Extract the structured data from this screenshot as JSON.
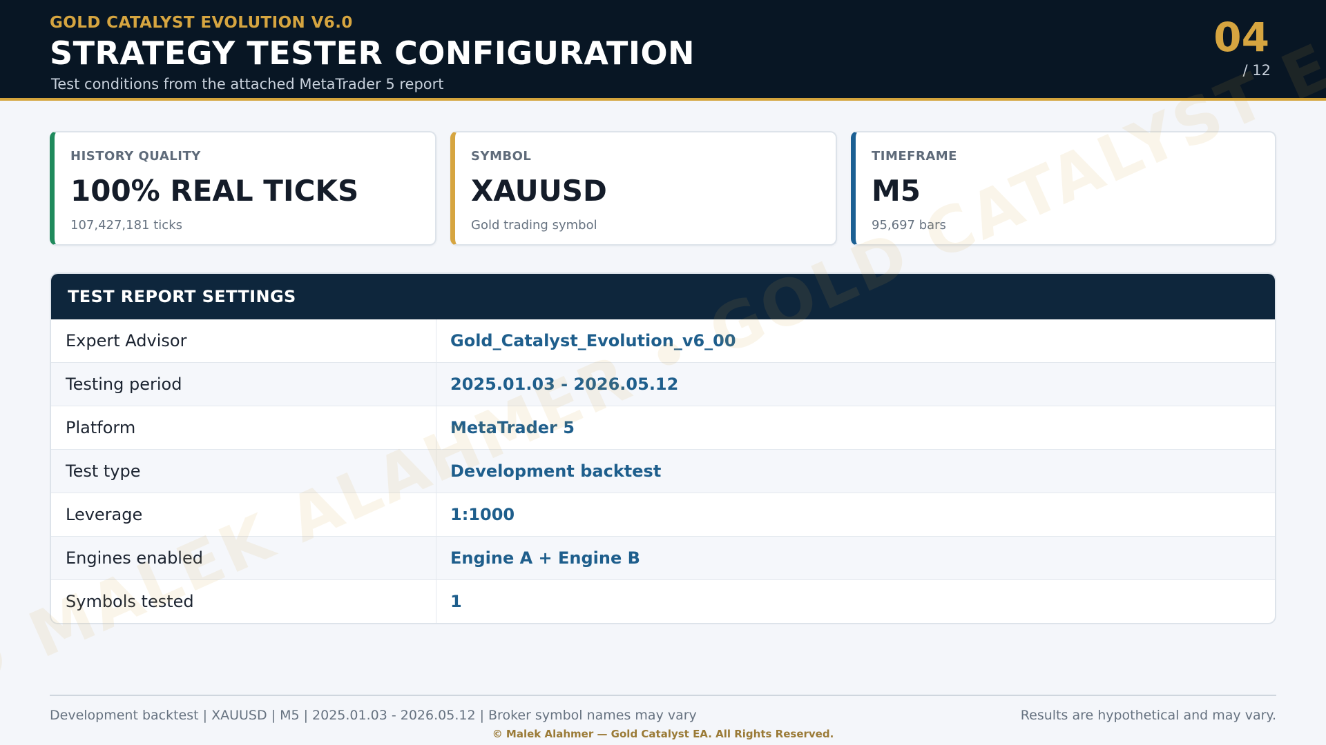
{
  "header": {
    "eyebrow": "GOLD CATALYST EVOLUTION V6.0",
    "title": "STRATEGY TESTER CONFIGURATION",
    "subtitle": "Test conditions from the attached MetaTrader 5 report",
    "page_number": "04",
    "page_total": "/ 12"
  },
  "watermark": "© MALEK ALAHMER • GOLD CATALYST EA",
  "cards": [
    {
      "label": "HISTORY QUALITY",
      "value": "100% REAL TICKS",
      "sub": "107,427,181 ticks",
      "accent": "#1f8a5c"
    },
    {
      "label": "SYMBOL",
      "value": "XAUUSD",
      "sub": "Gold trading symbol",
      "accent": "#d6a540"
    },
    {
      "label": "TIMEFRAME",
      "value": "M5",
      "sub": "95,697 bars",
      "accent": "#1b5f93"
    }
  ],
  "settings": {
    "heading": "TEST REPORT SETTINGS",
    "rows": [
      {
        "key": "Expert Advisor",
        "value": "Gold_Catalyst_Evolution_v6_00"
      },
      {
        "key": "Testing period",
        "value": "2025.01.03 - 2026.05.12"
      },
      {
        "key": "Platform",
        "value": "MetaTrader 5"
      },
      {
        "key": "Test type",
        "value": "Development backtest"
      },
      {
        "key": "Leverage",
        "value": "1:1000"
      },
      {
        "key": "Engines enabled",
        "value": "Engine A + Engine B"
      },
      {
        "key": "Symbols tested",
        "value": "1"
      }
    ]
  },
  "footer": {
    "left": "Development backtest | XAUUSD | M5 | 2025.01.03 - 2026.05.12 | Broker symbol names may vary",
    "right": "Results are hypothetical and may vary.",
    "copyright": "© Malek Alahmer — Gold Catalyst EA. All Rights Reserved."
  },
  "colors": {
    "header_bg": "#081624",
    "gold_accent": "#d6a540",
    "table_head_bg": "#0e263c",
    "value_blue": "#1e5e8c"
  }
}
